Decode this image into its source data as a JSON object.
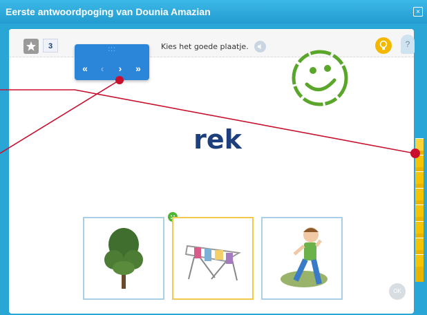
{
  "window": {
    "title": "Eerste antwoordpoging van Dounia Amazian",
    "close_glyph": "×"
  },
  "toolbar": {
    "level": "3",
    "instruction": "Kies het goede plaatje."
  },
  "nav": {
    "grip": ":::",
    "first": "«",
    "prev": "‹",
    "next": "›",
    "last": "»"
  },
  "exercise": {
    "word": "rek"
  },
  "choices": [
    {
      "name": "tree"
    },
    {
      "name": "drying-rack",
      "selected": true
    },
    {
      "name": "boy"
    }
  ],
  "ok": {
    "label": "OK"
  },
  "help": {
    "label": "?"
  },
  "colors": {
    "accent": "#29a6d6",
    "word": "#1d3f7d",
    "selected_border": "#f2c94c",
    "progress": "#f4c400",
    "annotation": "#c8102e"
  }
}
